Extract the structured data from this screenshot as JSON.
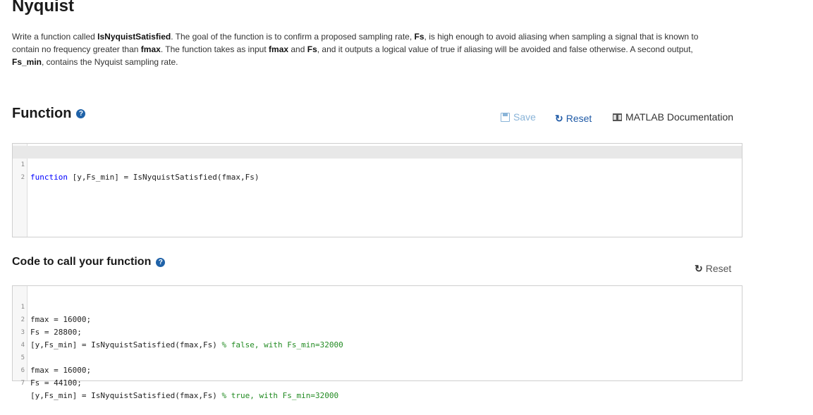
{
  "problem": {
    "title": "Nyquist",
    "desc": {
      "p1": "Write a function called ",
      "fn_name": "IsNyquistSatisfied",
      "p2": ". The goal of the function is to confirm a proposed sampling rate, ",
      "fs": "Fs",
      "p3": ", is high enough to avoid aliasing when sampling a signal that is known to contain no frequency greater than ",
      "fmax": "fmax",
      "p4": ". The function takes as input ",
      "fmax2": "fmax",
      "p5": " and ",
      "fs2": "Fs",
      "p6": ", and it outputs a logical value of true if aliasing will be avoided and false otherwise. A second output, ",
      "fsmin": "Fs_min",
      "p7": ", contains the Nyquist sampling rate."
    }
  },
  "function_section": {
    "title": "Function",
    "help_icon": "?",
    "toolbar": {
      "save_label": "Save",
      "reset_label": "Reset",
      "doc_label": "MATLAB Documentation"
    },
    "lines": [
      {
        "num": "1",
        "kw": "function",
        "rest": " [y,Fs_min] = IsNyquistSatisfied(fmax,Fs)"
      },
      {
        "num": "2",
        "kw": "",
        "rest": ""
      }
    ]
  },
  "call_section": {
    "title": "Code to call your function",
    "help_icon": "?",
    "reset_label": "Reset",
    "lines": [
      {
        "num": "1",
        "code": "fmax = 16000;",
        "comment": ""
      },
      {
        "num": "2",
        "code": "Fs = 28800;",
        "comment": ""
      },
      {
        "num": "3",
        "code": "[y,Fs_min] = IsNyquistSatisfied(fmax,Fs) ",
        "comment": "% false, with Fs_min=32000"
      },
      {
        "num": "4",
        "code": "",
        "comment": ""
      },
      {
        "num": "5",
        "code": "fmax = 16000;",
        "comment": ""
      },
      {
        "num": "6",
        "code": "Fs = 44100;",
        "comment": ""
      },
      {
        "num": "7",
        "code": "[y,Fs_min] = IsNyquistSatisfied(fmax,Fs) ",
        "comment": "% true, with Fs_min=32000"
      }
    ]
  },
  "icons": {
    "help": "question-circle-icon",
    "save": "floppy-disk-icon",
    "reset": "refresh-icon",
    "doc": "book-icon"
  },
  "colors": {
    "accent": "#1f5aa6",
    "save_disabled": "#8ab4d8",
    "keyword": "#0000ff",
    "comment": "#228b22"
  }
}
